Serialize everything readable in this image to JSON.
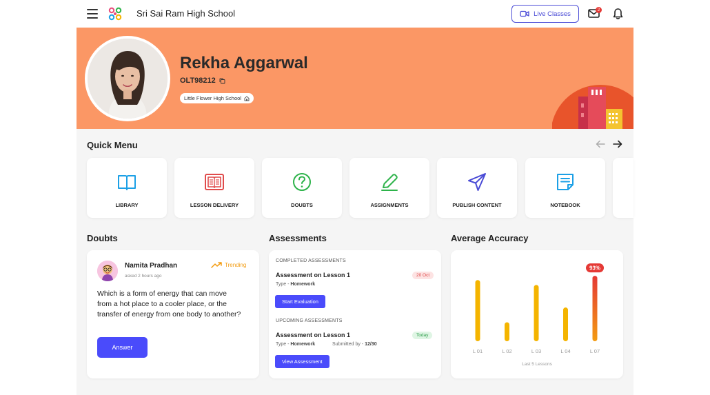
{
  "header": {
    "school_name": "Sri Sai Ram High School",
    "live_classes_label": "Live Classes",
    "mail_badge_count": "2"
  },
  "profile": {
    "name": "Rekha Aggarwal",
    "id": "OLT98212",
    "school": "Little Flower High School"
  },
  "quick_menu": {
    "title": "Quick Menu",
    "items": [
      {
        "label": "LIBRARY",
        "icon": "book-icon",
        "color": "#1ca0e6"
      },
      {
        "label": "LESSON DELIVERY",
        "icon": "lesson-book-icon",
        "color": "#e04b4b"
      },
      {
        "label": "DOUBTS",
        "icon": "question-icon",
        "color": "#2db34a"
      },
      {
        "label": "ASSIGNMENTS",
        "icon": "pencil-icon",
        "color": "#2db34a"
      },
      {
        "label": "PUBLISH CONTENT",
        "icon": "send-icon",
        "color": "#4a4bd6"
      },
      {
        "label": "NOTEBOOK",
        "icon": "notebook-icon",
        "color": "#1ca0e6"
      }
    ]
  },
  "doubts": {
    "title": "Doubts",
    "user": "Namita Pradhan",
    "time": "asked 2 hours ago",
    "trending_label": "Trending",
    "question": "Which is a form of energy that can move from a hot place to a cooler place, or the transfer of energy from one body to another?",
    "answer_label": "Answer"
  },
  "assessments": {
    "title": "Assessments",
    "completed_label": "COMPLETED ASSESSMENTS",
    "completed": {
      "title": "Assessment on Lesson 1",
      "type_prefix": "Type - ",
      "type": "Homework",
      "date": "20 Oct",
      "button": "Start Evaluation"
    },
    "upcoming_label": "UPCOMING ASSESSMENTS",
    "upcoming": {
      "title": "Assessment on Lesson 1",
      "type_prefix": "Type - ",
      "type": "Homework",
      "submitted_prefix": "Submitted by - ",
      "submitted": "12/30",
      "date": "Today",
      "button": "View Assessment"
    }
  },
  "accuracy": {
    "title": "Average Accuracy",
    "footer": "Last 5 Lessons",
    "highlight_label": "93%",
    "chart_data": {
      "type": "bar",
      "categories": [
        "L 01",
        "L 02",
        "L 03",
        "L 04",
        "L 07"
      ],
      "values": [
        87,
        27,
        80,
        48,
        93
      ],
      "ylim": [
        0,
        100
      ],
      "bar_color": "#f4b400",
      "highlight_color": "#e53935",
      "highlight_index": 4
    }
  }
}
